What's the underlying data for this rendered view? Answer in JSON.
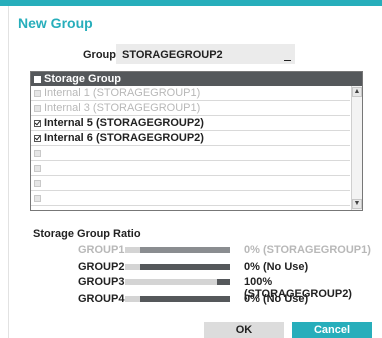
{
  "dialog": {
    "title": "New Group"
  },
  "group": {
    "label": "Group",
    "value": "STORAGEGROUP2"
  },
  "table": {
    "header": "Storage Group",
    "rows": [
      {
        "label": "Internal 1 (STORAGEGROUP1)",
        "checked": false,
        "state": "disabled"
      },
      {
        "label": "Internal 3 (STORAGEGROUP1)",
        "checked": false,
        "state": "disabled"
      },
      {
        "label": "Internal 5 (STORAGEGROUP2)",
        "checked": true,
        "state": "active"
      },
      {
        "label": "Internal 6 (STORAGEGROUP2)",
        "checked": true,
        "state": "active"
      },
      {
        "label": "",
        "checked": false,
        "state": "empty"
      },
      {
        "label": "",
        "checked": false,
        "state": "empty"
      },
      {
        "label": "",
        "checked": false,
        "state": "empty"
      },
      {
        "label": "",
        "checked": false,
        "state": "empty"
      }
    ]
  },
  "ratio": {
    "title": "Storage Group Ratio",
    "groups": [
      {
        "name": "GROUP1",
        "percent": 0,
        "value": "0% (STORAGEGROUP1)",
        "state": "disabled"
      },
      {
        "name": "GROUP2",
        "percent": 0,
        "value": "0% (No Use)",
        "state": "active"
      },
      {
        "name": "GROUP3",
        "percent": 100,
        "value": "100% (STORAGEGROUP2)",
        "state": "active"
      },
      {
        "name": "GROUP4",
        "percent": 0,
        "value": "0% (No Use)",
        "state": "active"
      }
    ]
  },
  "buttons": {
    "ok": "OK",
    "cancel": "Cancel"
  },
  "colors": {
    "accent": "#27aebb",
    "header_bg": "#55585b"
  }
}
